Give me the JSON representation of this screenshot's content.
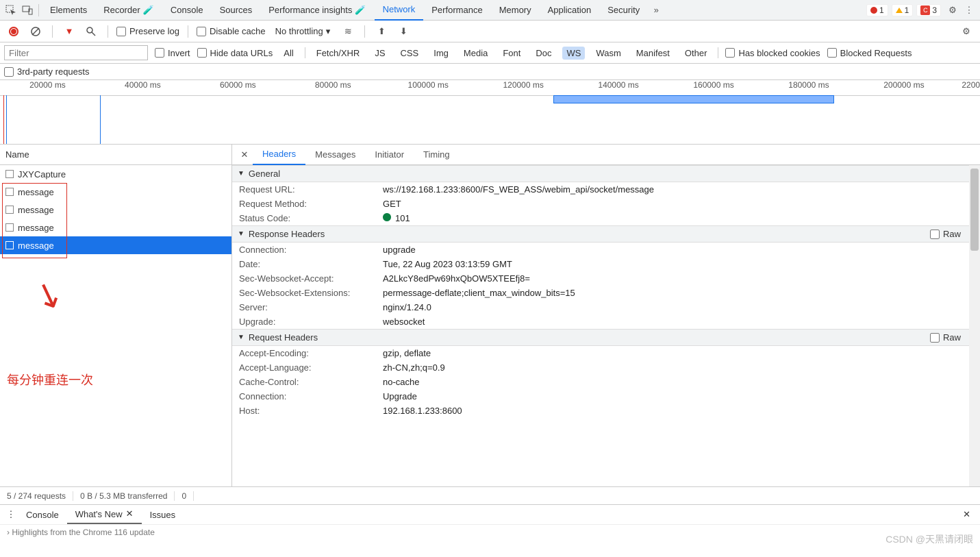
{
  "topbar": {
    "tabs": [
      "Elements",
      "Recorder",
      "Console",
      "Sources",
      "Performance insights",
      "Network",
      "Performance",
      "Memory",
      "Application",
      "Security"
    ],
    "active": "Network",
    "error_count": "1",
    "warn_count": "1",
    "ext_count": "3"
  },
  "net_toolbar": {
    "preserve_log": "Preserve log",
    "disable_cache": "Disable cache",
    "throttling": "No throttling"
  },
  "filterbar": {
    "filter_placeholder": "Filter",
    "invert": "Invert",
    "hide_data_urls": "Hide data URLs",
    "types": [
      "All",
      "Fetch/XHR",
      "JS",
      "CSS",
      "Img",
      "Media",
      "Font",
      "Doc",
      "WS",
      "Wasm",
      "Manifest",
      "Other"
    ],
    "active_type": "WS",
    "has_blocked_cookies": "Has blocked cookies",
    "blocked_requests": "Blocked Requests",
    "third_party": "3rd-party requests"
  },
  "timeline": {
    "labels": [
      "20000 ms",
      "40000 ms",
      "60000 ms",
      "80000 ms",
      "100000 ms",
      "120000 ms",
      "140000 ms",
      "160000 ms",
      "180000 ms",
      "200000 ms",
      "2200"
    ]
  },
  "left": {
    "header": "Name",
    "rows": [
      "JXYCapture",
      "message",
      "message",
      "message",
      "message"
    ],
    "selected_index": 4
  },
  "annotation": "每分钟重连一次",
  "detail": {
    "tabs": [
      "Headers",
      "Messages",
      "Initiator",
      "Timing"
    ],
    "active": "Headers",
    "sections": {
      "general_title": "General",
      "general": {
        "request_url_k": "Request URL:",
        "request_url_v": "ws://192.168.1.233:8600/FS_WEB_ASS/webim_api/socket/message",
        "request_method_k": "Request Method:",
        "request_method_v": "GET",
        "status_code_k": "Status Code:",
        "status_code_v": "101"
      },
      "response_title": "Response Headers",
      "raw": "Raw",
      "response": {
        "connection_k": "Connection:",
        "connection_v": "upgrade",
        "date_k": "Date:",
        "date_v": "Tue, 22 Aug 2023 03:13:59 GMT",
        "swa_k": "Sec-Websocket-Accept:",
        "swa_v": "A2LkcY8edPw69hxQbOW5XTEEfj8=",
        "swe_k": "Sec-Websocket-Extensions:",
        "swe_v": "permessage-deflate;client_max_window_bits=15",
        "server_k": "Server:",
        "server_v": "nginx/1.24.0",
        "upgrade_k": "Upgrade:",
        "upgrade_v": "websocket"
      },
      "request_title": "Request Headers",
      "request": {
        "ae_k": "Accept-Encoding:",
        "ae_v": "gzip, deflate",
        "al_k": "Accept-Language:",
        "al_v": "zh-CN,zh;q=0.9",
        "cc_k": "Cache-Control:",
        "cc_v": "no-cache",
        "conn_k": "Connection:",
        "conn_v": "Upgrade",
        "host_k": "Host:",
        "host_v": "192.168.1.233:8600"
      }
    }
  },
  "status": {
    "requests": "5 / 274 requests",
    "transferred": "0 B / 5.3 MB transferred",
    "more": "0"
  },
  "drawer": {
    "tabs": [
      "Console",
      "What's New",
      "Issues"
    ],
    "active": "What's New",
    "highlight": "Highlights from the Chrome 116 update"
  },
  "watermark": "CSDN @天黑请闭眼"
}
